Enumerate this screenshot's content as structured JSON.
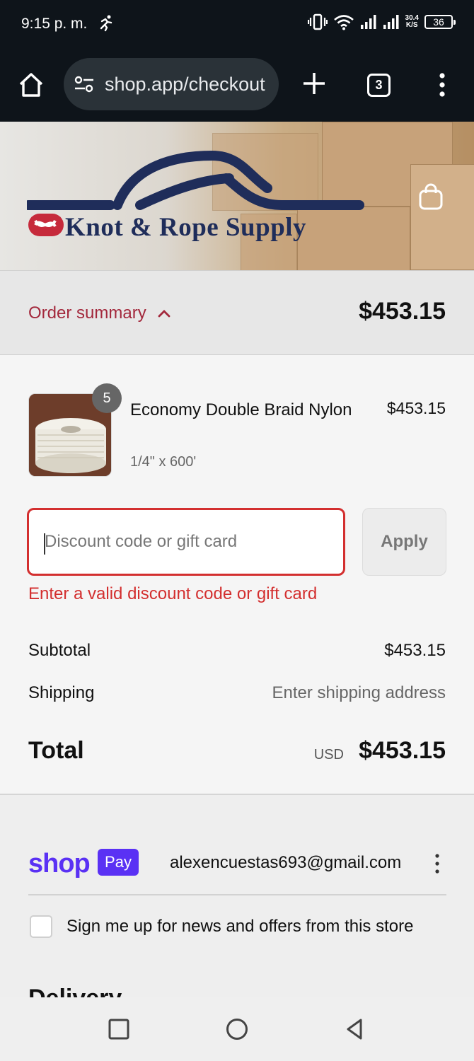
{
  "status_bar": {
    "time": "9:15 p. m.",
    "net_speed_value": "30.4",
    "net_speed_unit": "K/S",
    "battery": "36"
  },
  "browser": {
    "url": "shop.app/checkout",
    "tab_count": "3"
  },
  "store": {
    "name": "Knot & Rope Supply",
    "brand_color": "#1f2d5a",
    "accent_color": "#a3283c"
  },
  "summary": {
    "toggle_label": "Order summary",
    "total": "$453.15"
  },
  "line_item": {
    "quantity": "5",
    "name": "Economy Double Braid Nylon",
    "variant": "1/4\" x 600'",
    "price": "$453.15"
  },
  "discount": {
    "placeholder": "Discount code or gift card",
    "apply_label": "Apply",
    "error": "Enter a valid discount code or gift card",
    "error_color": "#d32f2f"
  },
  "totals": {
    "subtotal_label": "Subtotal",
    "subtotal_value": "$453.15",
    "shipping_label": "Shipping",
    "shipping_value": "Enter shipping address",
    "total_label": "Total",
    "currency": "USD",
    "total_value": "$453.15"
  },
  "shop_pay": {
    "logo_text": "shop",
    "badge": "Pay",
    "email": "alexencuestas693@gmail.com",
    "brand_color": "#5a31f4"
  },
  "newsletter": {
    "label": "Sign me up for news and offers from this store",
    "checked": false
  },
  "delivery": {
    "heading": "Delivery"
  },
  "icons": {
    "status": [
      "activity-icon",
      "vibrate-icon",
      "wifi-icon",
      "signal-icon",
      "battery-icon"
    ],
    "browser": [
      "home-icon",
      "site-settings-icon",
      "new-tab-icon",
      "tabs-icon",
      "more-icon"
    ],
    "nav": [
      "recents-icon",
      "home-circle-icon",
      "back-icon"
    ]
  }
}
